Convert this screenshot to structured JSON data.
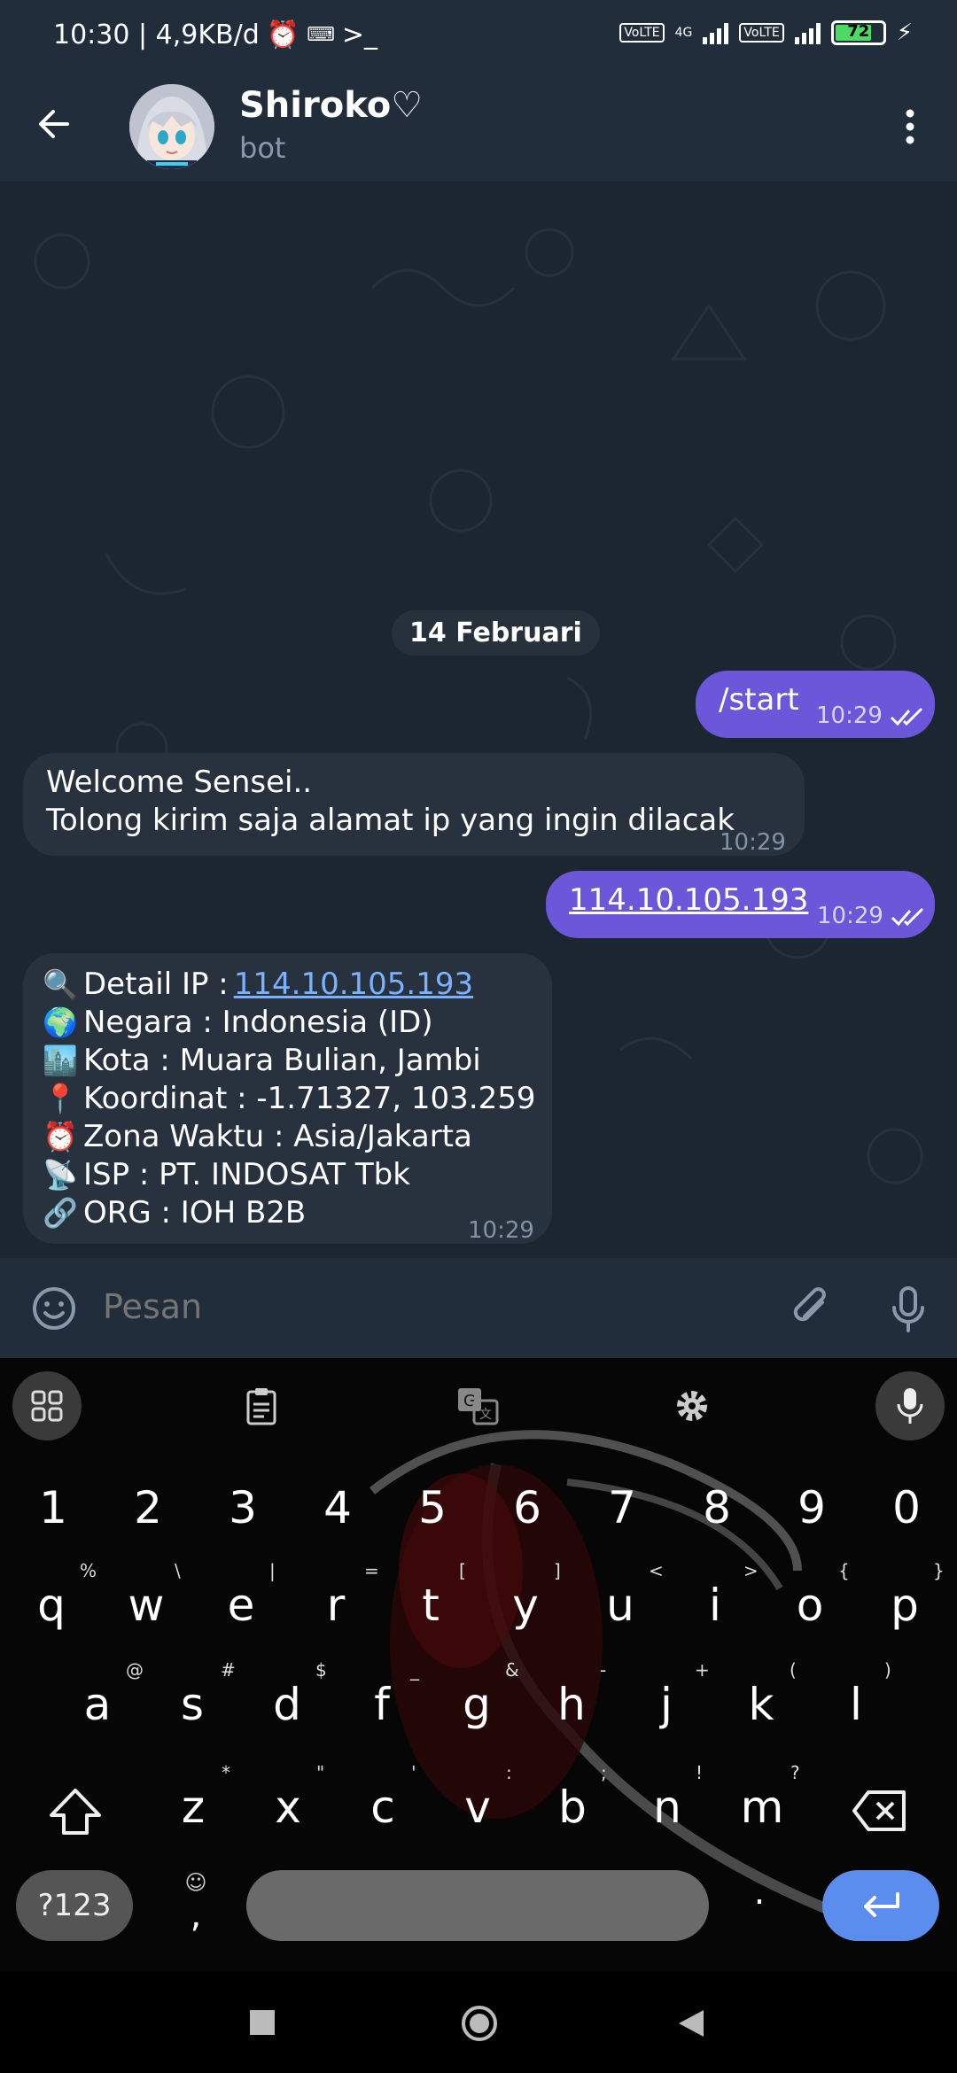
{
  "status_bar": {
    "time_speed": "10:30 | 4,9KB/d",
    "network_label": "4G",
    "volte_label": "Vo LTE",
    "battery": "72"
  },
  "header": {
    "title": "Shiroko♡",
    "subtitle": "bot"
  },
  "chat": {
    "date_separator": "14 Februari",
    "messages": [
      {
        "direction": "out",
        "text": "/start",
        "time": "10:29"
      },
      {
        "direction": "in",
        "lines": [
          "Welcome Sensei..",
          "Tolong kirim saja alamat ip yang ingin dilacak"
        ],
        "time": "10:29"
      },
      {
        "direction": "out",
        "text": "114.10.105.193",
        "time": "10:29"
      },
      {
        "direction": "in",
        "time": "10:29",
        "detail": [
          {
            "emoji": "🔍",
            "label": "Detail IP : ",
            "value": "114.10.105.193"
          },
          {
            "emoji": "🌍",
            "label": "Negara : Indonesia (ID)"
          },
          {
            "emoji": "🏙️",
            "label": "Kota : Muara Bulian, Jambi"
          },
          {
            "emoji": "📍",
            "label": "Koordinat : -1.71327, 103.259"
          },
          {
            "emoji": "⏰",
            "label": "Zona Waktu : Asia/Jakarta"
          },
          {
            "emoji": "📡",
            "label": "ISP : PT. INDOSAT Tbk"
          },
          {
            "emoji": "🔗",
            "label": "ORG : IOH B2B"
          }
        ]
      }
    ]
  },
  "input": {
    "placeholder": "Pesan"
  },
  "keyboard": {
    "numbers": [
      "1",
      "2",
      "3",
      "4",
      "5",
      "6",
      "7",
      "8",
      "9",
      "0"
    ],
    "row1": [
      "q",
      "w",
      "e",
      "r",
      "t",
      "y",
      "u",
      "i",
      "o",
      "p"
    ],
    "row1_hints": [
      "%",
      "\\",
      "|",
      "=",
      "[",
      "]",
      "<",
      ">",
      "{",
      "}"
    ],
    "row2": [
      "a",
      "s",
      "d",
      "f",
      "g",
      "h",
      "j",
      "k",
      "l"
    ],
    "row2_hints": [
      "@",
      "#",
      "$",
      "_",
      "&",
      "-",
      "+",
      "(",
      ")"
    ],
    "row3": [
      "z",
      "x",
      "c",
      "v",
      "b",
      "n",
      "m"
    ],
    "row3_hints": [
      "*",
      "\"",
      "'",
      ":",
      ";",
      "!",
      "?"
    ],
    "symbols_label": "?123",
    "comma": ",",
    "period": ".",
    "accent": "#5b8def"
  }
}
